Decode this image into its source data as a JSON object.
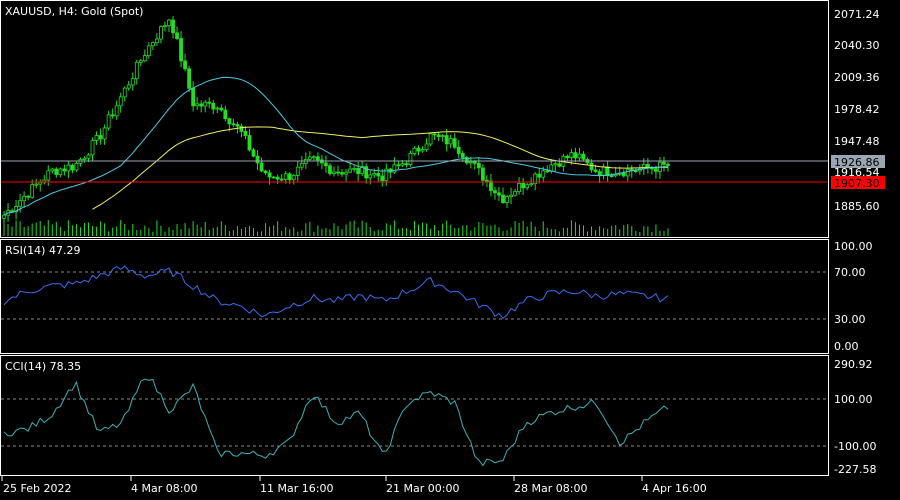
{
  "main_pane": {
    "title": "XAUUSD, H4:  Gold (Spot)",
    "price_ticks": [
      "2071.24",
      "2040.30",
      "2009.36",
      "1978.42",
      "1947.48",
      "1916.54",
      "1885.60"
    ],
    "bid_tag": "1926.86",
    "red_tag": "1907.30",
    "colors": {
      "candles": "#22dd22",
      "volume": "#22dd22",
      "ma_fast": "#4cc9e6",
      "ma_slow": "#f0f060",
      "bid_line": "#9aa6b2",
      "red_line": "#ff0000"
    }
  },
  "rsi_pane": {
    "title": "RSI(14) 47.29",
    "ticks": [
      "100.00",
      "70.00",
      "30.00",
      "0.00"
    ],
    "line_color": "#3b6df0"
  },
  "cci_pane": {
    "title": "CCI(14) 78.35",
    "ticks": [
      "290.92",
      "100.00",
      "-100.00",
      "-227.58"
    ],
    "line_color": "#40b0b8"
  },
  "time_axis": [
    "25 Feb 2022",
    "4 Mar 08:00",
    "11 Mar 16:00",
    "21 Mar 00:00",
    "28 Mar 08:00",
    "4 Apr 16:00"
  ],
  "chart_data": {
    "type": "line",
    "title": "XAUUSD, H4:  Gold (Spot)",
    "x": [
      "25 Feb 2022",
      "4 Mar 08:00",
      "11 Mar 16:00",
      "21 Mar 00:00",
      "28 Mar 08:00",
      "4 Apr 16:00"
    ],
    "series": [
      {
        "values": [
          1890,
          1910,
          1930,
          1935,
          1960,
          2000,
          2040,
          2070,
          1990,
          1990,
          1965,
          1925,
          1925,
          1940,
          1930,
          1930,
          1925,
          1940,
          1962,
          1955,
          1930,
          1905,
          1920,
          1935,
          1945,
          1930,
          1930,
          1932,
          1935
        ]
      },
      {
        "name": "RSI(14) 47.29",
        "values": [
          45,
          55,
          60,
          62,
          70,
          78,
          70,
          75,
          60,
          45,
          40,
          30,
          40,
          48,
          45,
          50,
          45,
          55,
          65,
          55,
          42,
          30,
          45,
          52,
          55,
          50,
          52,
          50,
          47
        ]
      },
      {
        "name": "CCI(14) 78.35",
        "values": [
          -50,
          -30,
          40,
          200,
          -50,
          0,
          250,
          60,
          180,
          -150,
          -150,
          -160,
          -100,
          150,
          0,
          50,
          -170,
          100,
          150,
          100,
          -200,
          -190,
          0,
          50,
          80,
          100,
          -100,
          0,
          78
        ]
      }
    ],
    "ylim": [
      1870,
      2080
    ]
  }
}
